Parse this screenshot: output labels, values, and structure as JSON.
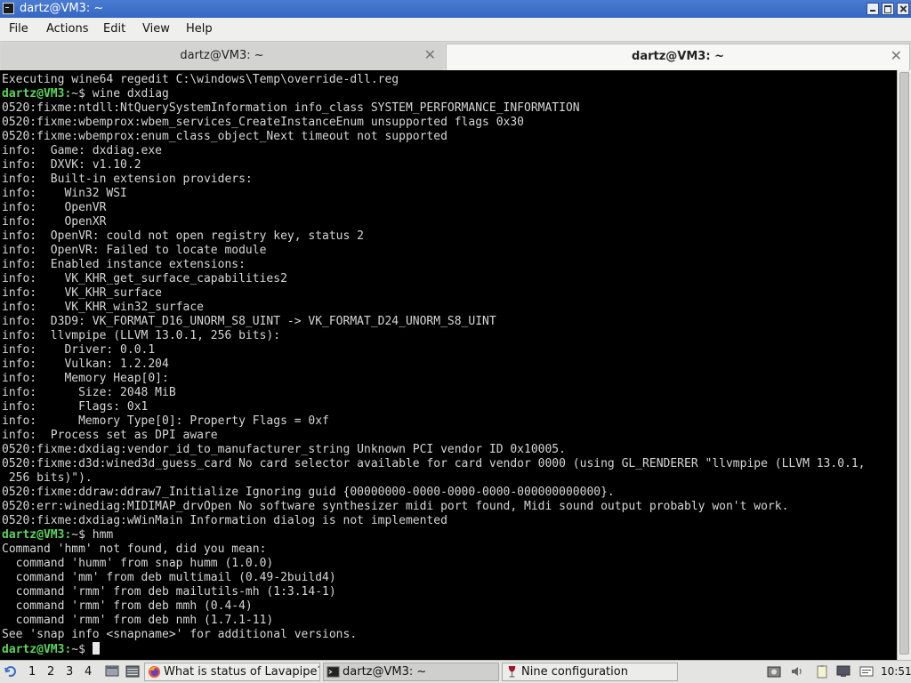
{
  "window": {
    "title": "dartz@VM3: ~"
  },
  "menu": [
    "File",
    "Actions",
    "Edit",
    "View",
    "Help"
  ],
  "tabs": [
    {
      "label": "dartz@VM3: ~",
      "active": false
    },
    {
      "label": "dartz@VM3: ~",
      "active": true
    }
  ],
  "tab_close_glyph": "✕",
  "terminal": {
    "prompt": "dartz@VM3:",
    "lines": [
      {
        "text": "Executing wine64 regedit C:\\windows\\Temp\\override-dll.reg"
      },
      {
        "prompt": "dartz@VM3:",
        "text": "~$ wine dxdiag"
      },
      {
        "text": "0520:fixme:ntdll:NtQuerySystemInformation info_class SYSTEM_PERFORMANCE_INFORMATION"
      },
      {
        "text": "0520:fixme:wbemprox:wbem_services_CreateInstanceEnum unsupported flags 0x30"
      },
      {
        "text": "0520:fixme:wbemprox:enum_class_object_Next timeout not supported"
      },
      {
        "text": "info:  Game: dxdiag.exe"
      },
      {
        "text": "info:  DXVK: v1.10.2"
      },
      {
        "text": "info:  Built-in extension providers:"
      },
      {
        "text": "info:    Win32 WSI"
      },
      {
        "text": "info:    OpenVR"
      },
      {
        "text": "info:    OpenXR"
      },
      {
        "text": "info:  OpenVR: could not open registry key, status 2"
      },
      {
        "text": "info:  OpenVR: Failed to locate module"
      },
      {
        "text": "info:  Enabled instance extensions:"
      },
      {
        "text": "info:    VK_KHR_get_surface_capabilities2"
      },
      {
        "text": "info:    VK_KHR_surface"
      },
      {
        "text": "info:    VK_KHR_win32_surface"
      },
      {
        "text": "info:  D3D9: VK_FORMAT_D16_UNORM_S8_UINT -> VK_FORMAT_D24_UNORM_S8_UINT"
      },
      {
        "text": "info:  llvmpipe (LLVM 13.0.1, 256 bits):"
      },
      {
        "text": "info:    Driver: 0.0.1"
      },
      {
        "text": "info:    Vulkan: 1.2.204"
      },
      {
        "text": "info:    Memory Heap[0]:"
      },
      {
        "text": "info:      Size: 2048 MiB"
      },
      {
        "text": "info:      Flags: 0x1"
      },
      {
        "text": "info:      Memory Type[0]: Property Flags = 0xf"
      },
      {
        "text": "info:  Process set as DPI aware"
      },
      {
        "text": "0520:fixme:dxdiag:vendor_id_to_manufacturer_string Unknown PCI vendor ID 0x10005."
      },
      {
        "text": "0520:fixme:d3d:wined3d_guess_card No card selector available for card vendor 0000 (using GL_RENDERER \"llvmpipe (LLVM 13.0.1,"
      },
      {
        "text": " 256 bits)\")."
      },
      {
        "text": "0520:fixme:ddraw:ddraw7_Initialize Ignoring guid {00000000-0000-0000-0000-000000000000}."
      },
      {
        "text": "0520:err:winediag:MIDIMAP_drvOpen No software synthesizer midi port found, Midi sound output probably won't work."
      },
      {
        "text": "0520:fixme:dxdiag:wWinMain Information dialog is not implemented"
      },
      {
        "prompt": "dartz@VM3:",
        "text": "~$ hmm"
      },
      {
        "text": "Command 'hmm' not found, did you mean:"
      },
      {
        "text": "  command 'humm' from snap humm (1.0.0)"
      },
      {
        "text": "  command 'mm' from deb multimail (0.49-2build4)"
      },
      {
        "text": "  command 'rmm' from deb mailutils-mh (1:3.14-1)"
      },
      {
        "text": "  command 'rmm' from deb mmh (0.4-4)"
      },
      {
        "text": "  command 'rmm' from deb nmh (1.7.1-11)"
      },
      {
        "text": "See 'snap info <snapname>' for additional versions."
      },
      {
        "prompt": "dartz@VM3:",
        "text": "~$ ",
        "cursor": true
      }
    ]
  },
  "taskbar": {
    "workspaces": [
      "1",
      "2",
      "3",
      "4"
    ],
    "tasks": [
      {
        "label": "What is status of Lavapipe?...",
        "icon": "firefox-icon",
        "active": false
      },
      {
        "label": "dartz@VM3: ~",
        "icon": "terminal-icon",
        "active": true
      },
      {
        "label": "Nine configuration",
        "icon": "wine-icon",
        "active": false
      }
    ],
    "clock": "10:51"
  },
  "colors": {
    "titlebar": "#3b6fc7",
    "prompt": "#5dd35d",
    "terminal_bg": "#000000",
    "terminal_fg": "#d6d6d6"
  }
}
